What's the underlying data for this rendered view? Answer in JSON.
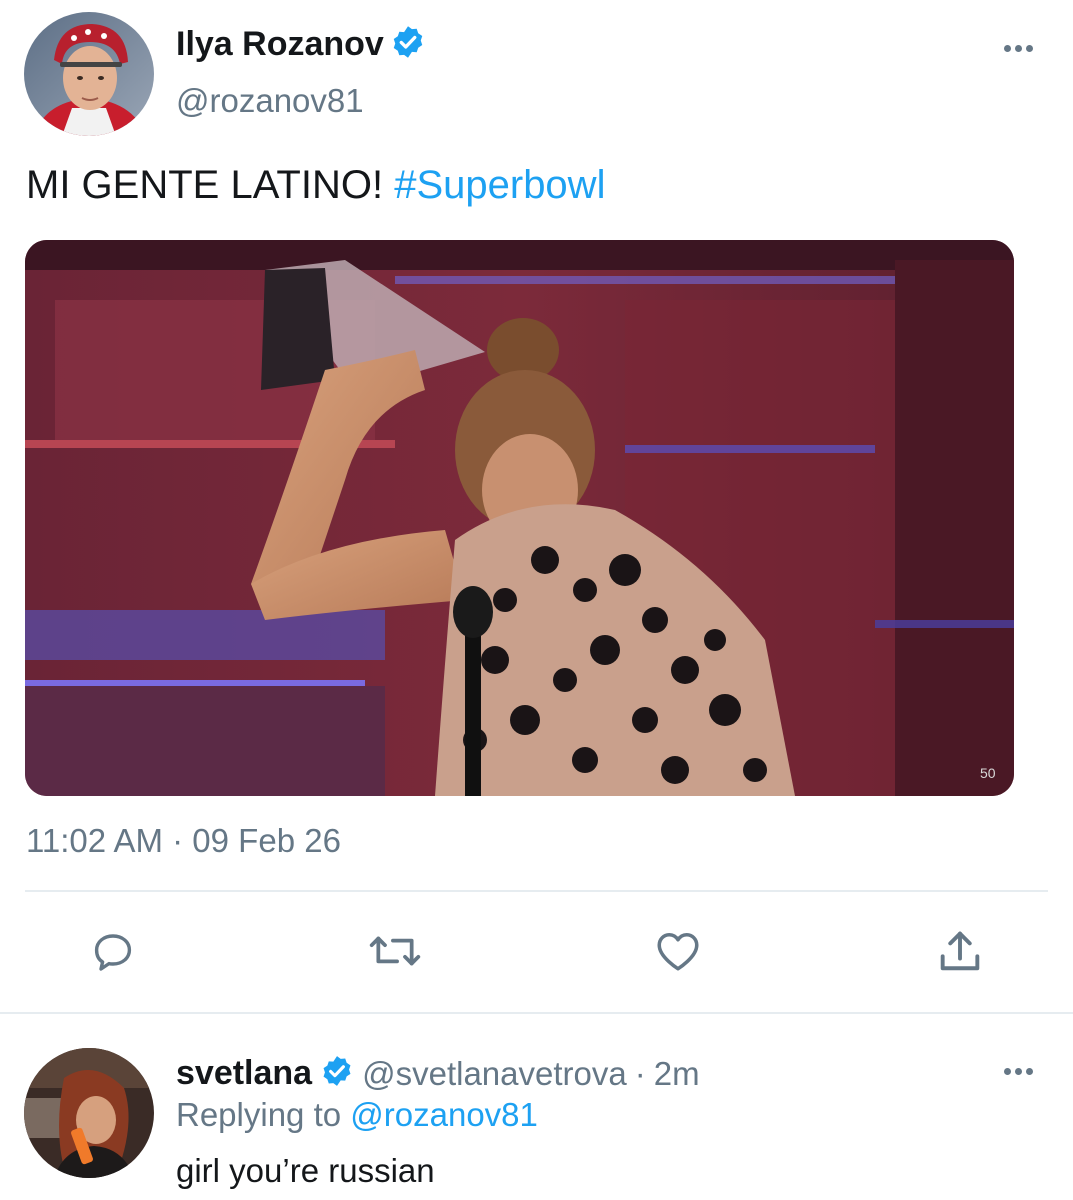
{
  "tweet": {
    "author_name": "Ilya Rozanov",
    "author_handle": "@rozanov81",
    "text": "MI GENTE LATINO!",
    "hashtag": "#Superbowl",
    "media_watermark": "50",
    "timestamp": "11:02 AM · 09 Feb 26"
  },
  "actions": [
    {
      "icon": "reply-icon"
    },
    {
      "icon": "retweet-icon"
    },
    {
      "icon": "like-icon"
    },
    {
      "icon": "share-icon"
    }
  ],
  "reply": {
    "author_name": "svetlana",
    "author_handle": "@svetlanavetrova",
    "separator": "·",
    "time_ago": "2m",
    "replying_prefix": "Replying to",
    "replying_handle": "@rozanov81",
    "text": "girl you’re russian"
  },
  "colors": {
    "accent": "#1da1f2",
    "secondary_text": "#657786",
    "divider": "#e6ecf0"
  }
}
